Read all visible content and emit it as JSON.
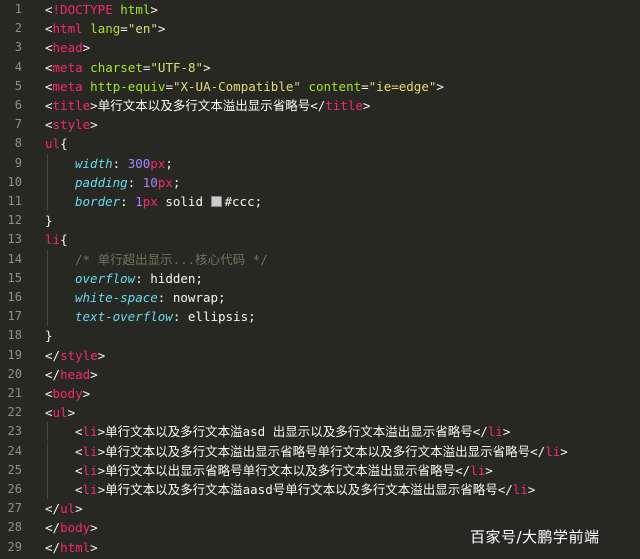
{
  "editor": {
    "theme_colors": {
      "background": "#272822",
      "tag": "#f92672",
      "attribute": "#a6e22e",
      "string": "#e6db74",
      "property": "#66d9ef",
      "number": "#ae81ff",
      "comment": "#75715e",
      "line_number": "#8f908a"
    },
    "lines": [
      {
        "n": "1",
        "indent": 0,
        "tokens": [
          [
            "p",
            "<"
          ],
          [
            "t",
            "!DOCTYPE"
          ],
          [
            "p",
            " "
          ],
          [
            "a",
            "html"
          ],
          [
            "p",
            ">"
          ]
        ]
      },
      {
        "n": "2",
        "indent": 0,
        "tokens": [
          [
            "p",
            "<"
          ],
          [
            "t",
            "html"
          ],
          [
            "p",
            " "
          ],
          [
            "a",
            "lang"
          ],
          [
            "p",
            "="
          ],
          [
            "s",
            "\"en\""
          ],
          [
            "p",
            ">"
          ]
        ]
      },
      {
        "n": "3",
        "indent": 0,
        "tokens": [
          [
            "p",
            "<"
          ],
          [
            "t",
            "head"
          ],
          [
            "p",
            ">"
          ]
        ]
      },
      {
        "n": "4",
        "indent": 0,
        "tokens": [
          [
            "p",
            "<"
          ],
          [
            "t",
            "meta"
          ],
          [
            "p",
            " "
          ],
          [
            "a",
            "charset"
          ],
          [
            "p",
            "="
          ],
          [
            "s",
            "\"UTF-8\""
          ],
          [
            "p",
            ">"
          ]
        ]
      },
      {
        "n": "5",
        "indent": 0,
        "tokens": [
          [
            "p",
            "<"
          ],
          [
            "t",
            "meta"
          ],
          [
            "p",
            " "
          ],
          [
            "a",
            "http-equiv"
          ],
          [
            "p",
            "="
          ],
          [
            "s",
            "\"X-UA-Compatible\""
          ],
          [
            "p",
            " "
          ],
          [
            "a",
            "content"
          ],
          [
            "p",
            "="
          ],
          [
            "s",
            "\"ie=edge\""
          ],
          [
            "p",
            ">"
          ]
        ]
      },
      {
        "n": "6",
        "indent": 0,
        "tokens": [
          [
            "p",
            "<"
          ],
          [
            "t",
            "title"
          ],
          [
            "p",
            ">单行文本以及多行文本溢出显示省略号</"
          ],
          [
            "t",
            "title"
          ],
          [
            "p",
            ">"
          ]
        ]
      },
      {
        "n": "7",
        "indent": 0,
        "tokens": [
          [
            "p",
            "<"
          ],
          [
            "t",
            "style"
          ],
          [
            "p",
            ">"
          ]
        ]
      },
      {
        "n": "8",
        "indent": 0,
        "tokens": [
          [
            "t",
            "ul"
          ],
          [
            "p",
            "{"
          ]
        ]
      },
      {
        "n": "9",
        "indent": 1,
        "tokens": [
          [
            "prop",
            "width"
          ],
          [
            "p",
            ": "
          ],
          [
            "num",
            "300"
          ],
          [
            "t",
            "px"
          ],
          [
            "p",
            ";"
          ]
        ]
      },
      {
        "n": "10",
        "indent": 1,
        "tokens": [
          [
            "prop",
            "padding"
          ],
          [
            "p",
            ": "
          ],
          [
            "num",
            "10"
          ],
          [
            "t",
            "px"
          ],
          [
            "p",
            ";"
          ]
        ]
      },
      {
        "n": "11",
        "indent": 1,
        "tokens": [
          [
            "prop",
            "border"
          ],
          [
            "p",
            ": "
          ],
          [
            "num",
            "1"
          ],
          [
            "t",
            "px"
          ],
          [
            "p",
            " solid "
          ],
          [
            "swatch",
            ""
          ],
          [
            "p",
            "#ccc;"
          ]
        ]
      },
      {
        "n": "12",
        "indent": 0,
        "tokens": [
          [
            "p",
            "}"
          ]
        ]
      },
      {
        "n": "13",
        "indent": 0,
        "tokens": [
          [
            "t",
            "li"
          ],
          [
            "p",
            "{"
          ]
        ]
      },
      {
        "n": "14",
        "indent": 1,
        "tokens": [
          [
            "cm",
            "/* 单行超出显示...核心代码 */"
          ]
        ]
      },
      {
        "n": "15",
        "indent": 1,
        "tokens": [
          [
            "prop",
            "overflow"
          ],
          [
            "p",
            ": hidden;"
          ]
        ]
      },
      {
        "n": "16",
        "indent": 1,
        "tokens": [
          [
            "prop",
            "white-space"
          ],
          [
            "p",
            ": nowrap;"
          ]
        ]
      },
      {
        "n": "17",
        "indent": 1,
        "tokens": [
          [
            "prop",
            "text-overflow"
          ],
          [
            "p",
            ": ellipsis;"
          ]
        ]
      },
      {
        "n": "18",
        "indent": 0,
        "tokens": [
          [
            "p",
            "}"
          ]
        ]
      },
      {
        "n": "19",
        "indent": 0,
        "tokens": [
          [
            "p",
            "</"
          ],
          [
            "t",
            "style"
          ],
          [
            "p",
            ">"
          ]
        ]
      },
      {
        "n": "20",
        "indent": 0,
        "tokens": [
          [
            "p",
            "</"
          ],
          [
            "t",
            "head"
          ],
          [
            "p",
            ">"
          ]
        ]
      },
      {
        "n": "21",
        "indent": 0,
        "tokens": [
          [
            "p",
            "<"
          ],
          [
            "t",
            "body"
          ],
          [
            "p",
            ">"
          ]
        ]
      },
      {
        "n": "22",
        "indent": 0,
        "tokens": [
          [
            "p",
            "<"
          ],
          [
            "t",
            "ul"
          ],
          [
            "p",
            ">"
          ]
        ]
      },
      {
        "n": "23",
        "indent": 1,
        "tokens": [
          [
            "p",
            "<"
          ],
          [
            "t",
            "li"
          ],
          [
            "p",
            ">单行文本以及多行文本溢asd 出显示以及多行文本溢出显示省略号</"
          ],
          [
            "t",
            "li"
          ],
          [
            "p",
            ">"
          ]
        ]
      },
      {
        "n": "24",
        "indent": 1,
        "tokens": [
          [
            "p",
            "<"
          ],
          [
            "t",
            "li"
          ],
          [
            "p",
            ">单行文本以及多行文本溢出显示省略号单行文本以及多行文本溢出显示省略号</"
          ],
          [
            "t",
            "li"
          ],
          [
            "p",
            ">"
          ]
        ]
      },
      {
        "n": "25",
        "indent": 1,
        "tokens": [
          [
            "p",
            "<"
          ],
          [
            "t",
            "li"
          ],
          [
            "p",
            ">单行文本以出显示省略号单行文本以及多行文本溢出显示省略号</"
          ],
          [
            "t",
            "li"
          ],
          [
            "p",
            ">"
          ]
        ]
      },
      {
        "n": "26",
        "indent": 1,
        "tokens": [
          [
            "p",
            "<"
          ],
          [
            "t",
            "li"
          ],
          [
            "p",
            ">单行文本以及多行文本溢aasd号单行文本以及多行文本溢出显示省略号</"
          ],
          [
            "t",
            "li"
          ],
          [
            "p",
            ">"
          ]
        ]
      },
      {
        "n": "27",
        "indent": 0,
        "tokens": [
          [
            "p",
            "</"
          ],
          [
            "t",
            "ul"
          ],
          [
            "p",
            ">"
          ]
        ]
      },
      {
        "n": "28",
        "indent": 0,
        "tokens": [
          [
            "p",
            "</"
          ],
          [
            "t",
            "body"
          ],
          [
            "p",
            ">"
          ]
        ]
      },
      {
        "n": "29",
        "indent": 0,
        "tokens": [
          [
            "p",
            "</"
          ],
          [
            "t",
            "html"
          ],
          [
            "p",
            ">"
          ]
        ]
      }
    ]
  },
  "watermark": "百家号/大鹏学前端"
}
